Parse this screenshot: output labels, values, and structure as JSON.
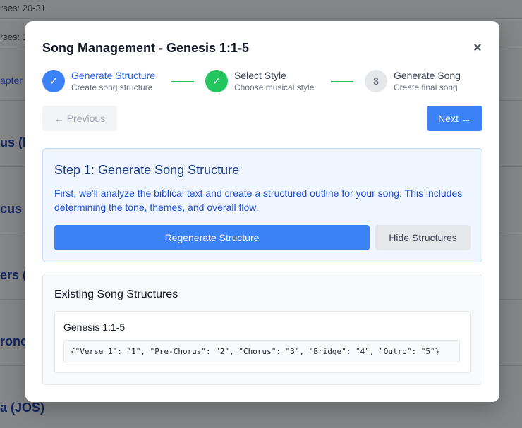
{
  "background": {
    "rows": [
      {
        "text": "rses: 20-31"
      },
      {
        "text": "rses: 1"
      },
      {
        "text": "apter 2"
      },
      {
        "text": "us (E"
      },
      {
        "text": "cus ("
      },
      {
        "text": "ers ("
      },
      {
        "text": "ronc"
      },
      {
        "text": "a (JOS)"
      }
    ]
  },
  "modal": {
    "title": "Song Management - Genesis 1:1-5",
    "close_icon": "×",
    "steps": [
      {
        "icon": "✓",
        "label": "Generate Structure",
        "sublabel": "Create song structure",
        "state": "active"
      },
      {
        "icon": "✓",
        "label": "Select Style",
        "sublabel": "Choose musical style",
        "state": "done"
      },
      {
        "icon": "3",
        "label": "Generate Song",
        "sublabel": "Create final song",
        "state": "pending"
      }
    ],
    "prev_label": "← Previous",
    "next_label": "Next →",
    "step_panel": {
      "heading": "Step 1: Generate Song Structure",
      "description": "First, we'll analyze the biblical text and create a structured outline for your song. This includes determining the tone, themes, and overall flow.",
      "regenerate_label": "Regenerate Structure",
      "hide_label": "Hide Structures"
    },
    "existing": {
      "heading": "Existing Song Structures",
      "structures": [
        {
          "title": "Genesis 1:1-5",
          "json": "{\"Verse 1\": \"1\", \"Pre-Chorus\": \"2\", \"Chorus\": \"3\", \"Bridge\": \"4\", \"Outro\": \"5\"}"
        }
      ]
    }
  },
  "colors": {
    "primary": "#3b82f6",
    "success": "#22c55e",
    "panel_bg": "#eff6ff"
  }
}
